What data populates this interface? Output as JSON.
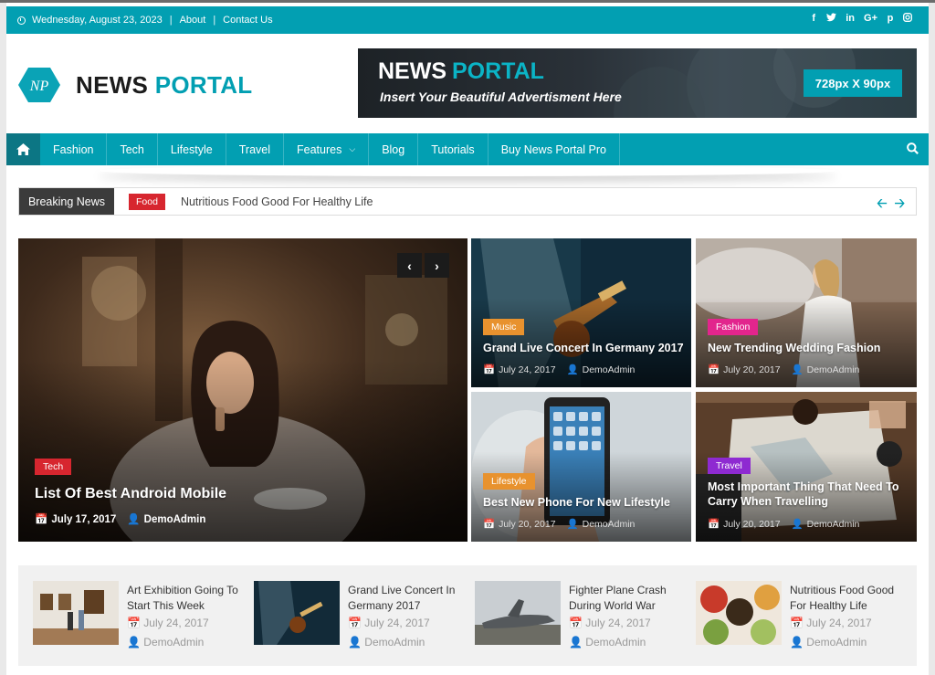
{
  "topbar": {
    "date": "Wednesday, August 23, 2023",
    "links": [
      "About",
      "Contact Us"
    ],
    "social": [
      "f",
      "t",
      "in",
      "G+",
      "p",
      "ig"
    ]
  },
  "logo": {
    "initials": "NP",
    "part1": "NEWS",
    "part2": "PORTAL"
  },
  "ad": {
    "part1": "NEWS",
    "part2": "PORTAL",
    "tagline": "Insert Your Beautiful Advertisment Here",
    "size": "728px X 90px"
  },
  "nav": {
    "items": [
      "Fashion",
      "Tech",
      "Lifestyle",
      "Travel",
      "Features",
      "Blog",
      "Tutorials",
      "Buy News Portal Pro"
    ]
  },
  "breaking": {
    "label": "Breaking News",
    "category": "Food",
    "headline": "Nutritious Food Good For Healthy Life"
  },
  "featured": {
    "main": {
      "tag": "Tech",
      "title": "List Of Best Android Mobile",
      "date": "July 17, 2017",
      "author": "DemoAdmin"
    },
    "tiles": [
      {
        "tag": "Music",
        "title": "Grand Live Concert In Germany 2017",
        "date": "July 24, 2017",
        "author": "DemoAdmin"
      },
      {
        "tag": "Fashion",
        "title": "New Trending Wedding Fashion",
        "date": "July 20, 2017",
        "author": "DemoAdmin"
      },
      {
        "tag": "Lifestyle",
        "title": "Best New Phone For New Lifestyle",
        "date": "July 20, 2017",
        "author": "DemoAdmin"
      },
      {
        "tag": "Travel",
        "title": "Most Important Thing That Need To Carry When Travelling",
        "date": "July 20, 2017",
        "author": "DemoAdmin"
      }
    ]
  },
  "posts": [
    {
      "title": "Art Exhibition Going To Start This Week",
      "date": "July 24, 2017",
      "author": "DemoAdmin"
    },
    {
      "title": "Grand Live Concert In Germany 2017",
      "date": "July 24, 2017",
      "author": "DemoAdmin"
    },
    {
      "title": "Fighter Plane Crash During World War",
      "date": "July 24, 2017",
      "author": "DemoAdmin"
    },
    {
      "title": "Nutritious Food Good For Healthy Life",
      "date": "July 24, 2017",
      "author": "DemoAdmin"
    }
  ],
  "colors": {
    "accent": "#029fb2",
    "tech": "#d7262f",
    "music": "#e8922e",
    "fashion": "#e2258d",
    "travel": "#8e2ad1"
  }
}
